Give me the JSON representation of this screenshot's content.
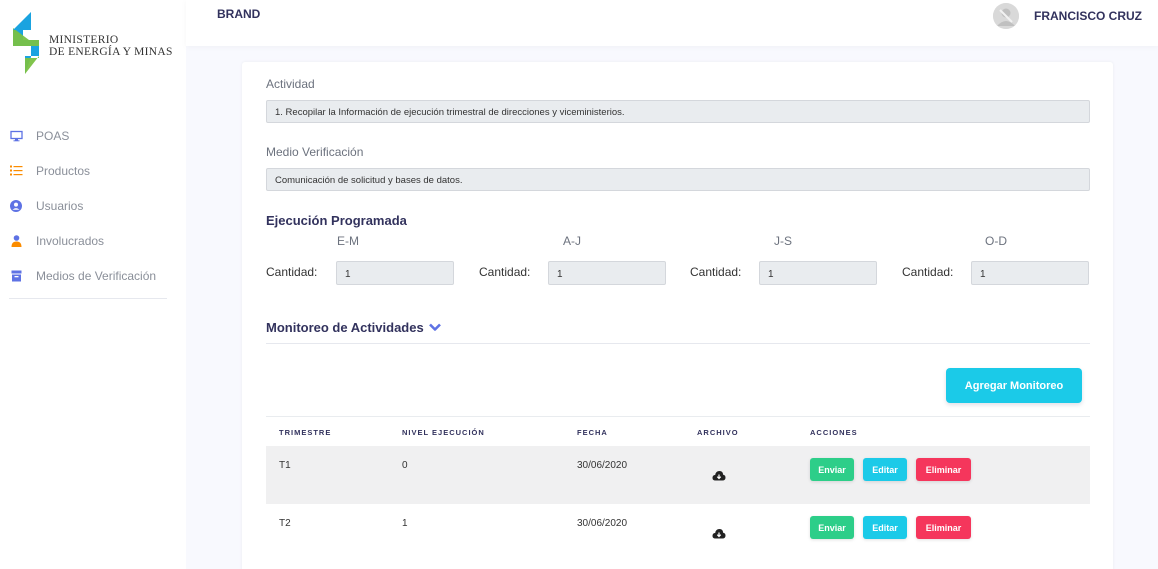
{
  "sidebar": {
    "logo_line1": "MINISTERIO",
    "logo_line2": "DE ENERGÍA Y MINAS",
    "items": [
      {
        "label": "POAS",
        "icon": "monitor-icon"
      },
      {
        "label": "Productos",
        "icon": "list-icon"
      },
      {
        "label": "Usuarios",
        "icon": "user-circle-icon"
      },
      {
        "label": "Involucrados",
        "icon": "person-icon"
      },
      {
        "label": "Medios de Verificación",
        "icon": "archive-icon"
      }
    ]
  },
  "topbar": {
    "brand": "BRAND",
    "user_name": "FRANCISCO CRUZ"
  },
  "form": {
    "actividad_label": "Actividad",
    "actividad_value": "1. Recopilar la Información de ejecución trimestral de direcciones y viceministerios.",
    "medio_label": "Medio Verificación",
    "medio_value": "Comunicación de solicitud y bases de datos.",
    "ejecucion_title": "Ejecución Programada",
    "periods": [
      {
        "name": "E-M",
        "qty_label": "Cantidad:",
        "qty": "1"
      },
      {
        "name": "A-J",
        "qty_label": "Cantidad:",
        "qty": "1"
      },
      {
        "name": "J-S",
        "qty_label": "Cantidad:",
        "qty": "1"
      },
      {
        "name": "O-D",
        "qty_label": "Cantidad:",
        "qty": "1"
      }
    ]
  },
  "monitoreo": {
    "title": "Monitoreo de Actividades",
    "add_button": "Agregar Monitoreo",
    "columns": [
      "TRIMESTRE",
      "NIVEL EJECUCIÓN",
      "FECHA",
      "ARCHIVO",
      "ACCIONES"
    ],
    "rows": [
      {
        "trimestre": "T1",
        "nivel": "0",
        "fecha": "30/06/2020"
      },
      {
        "trimestre": "T2",
        "nivel": "1",
        "fecha": "30/06/2020"
      }
    ],
    "actions": {
      "send": "Enviar",
      "edit": "Editar",
      "delete": "Eliminar"
    }
  },
  "colors": {
    "accent_cyan": "#1bcae8",
    "success": "#2dce89",
    "danger": "#f5365c",
    "logo_blue": "#1aa3e0",
    "logo_green": "#7ac143"
  }
}
